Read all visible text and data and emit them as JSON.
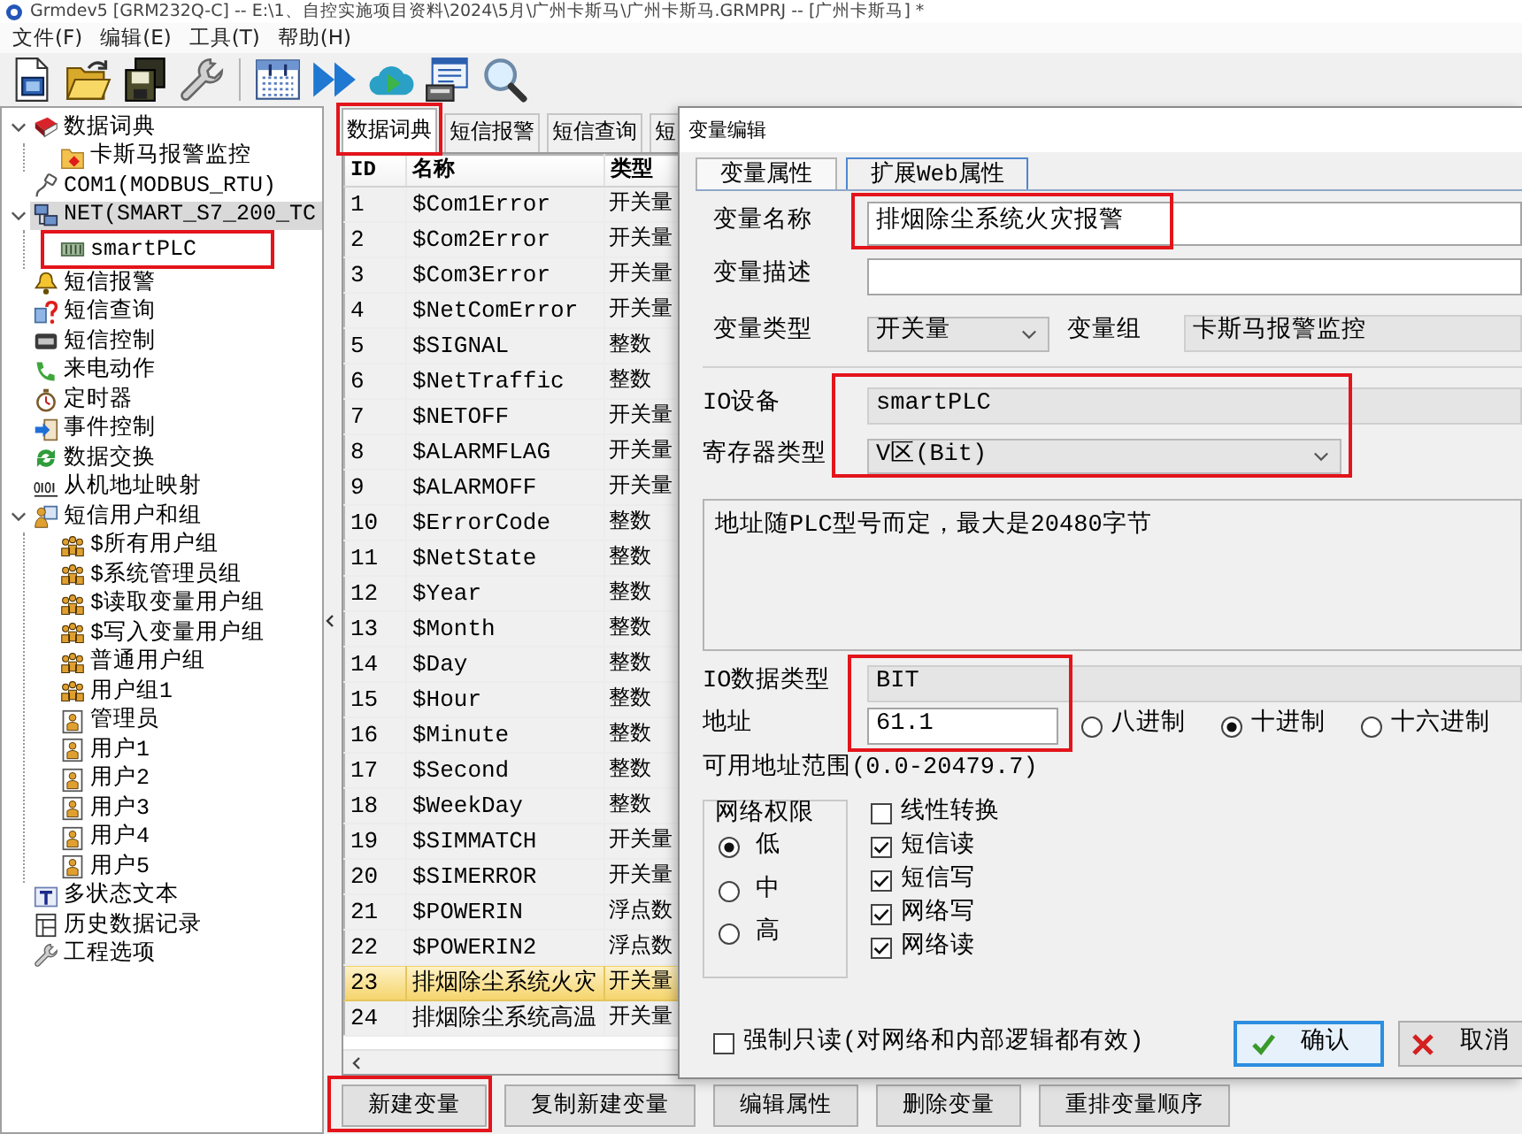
{
  "window": {
    "title": "Grmdev5 [GRM232Q-C]  -- E:\\1、自控实施项目资料\\2024\\5月\\广州卡斯马\\广州卡斯马.GRMPRJ -- [广州卡斯马] *"
  },
  "menu": [
    "文件(F)",
    "编辑(E)",
    "工具(T)",
    "帮助(H)"
  ],
  "tree": [
    {
      "label": "数据词典",
      "kind": "dictionary",
      "expanded": true,
      "selected": false,
      "highlighted": false,
      "children": [
        {
          "label": "卡斯马报警监控",
          "kind": "folder",
          "selected": false,
          "highlighted": false
        }
      ]
    },
    {
      "label": "COM1(MODBUS_RTU)",
      "kind": "serial",
      "selected": false,
      "highlighted": false
    },
    {
      "label": "NET(SMART_S7_200_TC",
      "kind": "network",
      "expanded": true,
      "selected": true,
      "highlighted": false,
      "children": [
        {
          "label": "smartPLC",
          "kind": "device",
          "selected": false,
          "highlighted": true
        }
      ]
    },
    {
      "label": "短信报警",
      "kind": "alarm",
      "selected": false,
      "highlighted": false
    },
    {
      "label": "短信查询",
      "kind": "query",
      "selected": false,
      "highlighted": false
    },
    {
      "label": "短信控制",
      "kind": "command",
      "selected": false,
      "highlighted": false
    },
    {
      "label": "来电动作",
      "kind": "call",
      "selected": false,
      "highlighted": false
    },
    {
      "label": "定时器",
      "kind": "timer",
      "selected": false,
      "highlighted": false
    },
    {
      "label": "事件控制",
      "kind": "event",
      "selected": false,
      "highlighted": false
    },
    {
      "label": "数据交换",
      "kind": "exchange",
      "selected": false,
      "highlighted": false
    },
    {
      "label": "从机地址映射",
      "kind": "mapping",
      "selected": false,
      "highlighted": false
    },
    {
      "label": "短信用户和组",
      "kind": "users",
      "expanded": true,
      "selected": false,
      "highlighted": false,
      "children": [
        {
          "label": "$所有用户组",
          "kind": "group",
          "selected": false,
          "highlighted": false
        },
        {
          "label": "$系统管理员组",
          "kind": "group",
          "selected": false,
          "highlighted": false
        },
        {
          "label": "$读取变量用户组",
          "kind": "group",
          "selected": false,
          "highlighted": false
        },
        {
          "label": "$写入变量用户组",
          "kind": "group",
          "selected": false,
          "highlighted": false
        },
        {
          "label": "普通用户组",
          "kind": "group",
          "selected": false,
          "highlighted": false
        },
        {
          "label": "用户组1",
          "kind": "group",
          "selected": false,
          "highlighted": false
        },
        {
          "label": "管理员",
          "kind": "user",
          "selected": false,
          "highlighted": false
        },
        {
          "label": "用户1",
          "kind": "user",
          "selected": false,
          "highlighted": false
        },
        {
          "label": "用户2",
          "kind": "user",
          "selected": false,
          "highlighted": false
        },
        {
          "label": "用户3",
          "kind": "user",
          "selected": false,
          "highlighted": false
        },
        {
          "label": "用户4",
          "kind": "user",
          "selected": false,
          "highlighted": false
        },
        {
          "label": "用户5",
          "kind": "user",
          "selected": false,
          "highlighted": false
        }
      ]
    },
    {
      "label": "多状态文本",
      "kind": "text",
      "selected": false,
      "highlighted": false
    },
    {
      "label": "历史数据记录",
      "kind": "history",
      "selected": false,
      "highlighted": false
    },
    {
      "label": "工程选项",
      "kind": "options",
      "selected": false,
      "highlighted": false
    }
  ],
  "tabs": [
    {
      "label": "数据词典",
      "selected": true,
      "highlighted": true
    },
    {
      "label": "短信报警",
      "selected": false,
      "highlighted": false
    },
    {
      "label": "短信查询",
      "selected": false,
      "highlighted": false
    },
    {
      "label": "短",
      "selected": false,
      "highlighted": false
    }
  ],
  "table": {
    "columns": [
      "ID",
      "名称",
      "类型"
    ],
    "rows": [
      {
        "cells": [
          "1",
          "$Com1Error",
          "开关量"
        ],
        "selected": false
      },
      {
        "cells": [
          "2",
          "$Com2Error",
          "开关量"
        ],
        "selected": false
      },
      {
        "cells": [
          "3",
          "$Com3Error",
          "开关量"
        ],
        "selected": false
      },
      {
        "cells": [
          "4",
          "$NetComError",
          "开关量"
        ],
        "selected": false
      },
      {
        "cells": [
          "5",
          "$SIGNAL",
          "整数"
        ],
        "selected": false
      },
      {
        "cells": [
          "6",
          "$NetTraffic",
          "整数"
        ],
        "selected": false
      },
      {
        "cells": [
          "7",
          "$NETOFF",
          "开关量"
        ],
        "selected": false
      },
      {
        "cells": [
          "8",
          "$ALARMFLAG",
          "开关量"
        ],
        "selected": false
      },
      {
        "cells": [
          "9",
          "$ALARMOFF",
          "开关量"
        ],
        "selected": false
      },
      {
        "cells": [
          "10",
          "$ErrorCode",
          "整数"
        ],
        "selected": false
      },
      {
        "cells": [
          "11",
          "$NetState",
          "整数"
        ],
        "selected": false
      },
      {
        "cells": [
          "12",
          "$Year",
          "整数"
        ],
        "selected": false
      },
      {
        "cells": [
          "13",
          "$Month",
          "整数"
        ],
        "selected": false
      },
      {
        "cells": [
          "14",
          "$Day",
          "整数"
        ],
        "selected": false
      },
      {
        "cells": [
          "15",
          "$Hour",
          "整数"
        ],
        "selected": false
      },
      {
        "cells": [
          "16",
          "$Minute",
          "整数"
        ],
        "selected": false
      },
      {
        "cells": [
          "17",
          "$Second",
          "整数"
        ],
        "selected": false
      },
      {
        "cells": [
          "18",
          "$WeekDay",
          "整数"
        ],
        "selected": false
      },
      {
        "cells": [
          "19",
          "$SIMMATCH",
          "开关量"
        ],
        "selected": false
      },
      {
        "cells": [
          "20",
          "$SIMERROR",
          "开关量"
        ],
        "selected": false
      },
      {
        "cells": [
          "21",
          "$POWERIN",
          "浮点数"
        ],
        "selected": false
      },
      {
        "cells": [
          "22",
          "$POWERIN2",
          "浮点数"
        ],
        "selected": false
      },
      {
        "cells": [
          "23",
          "排烟除尘系统火灾",
          "开关量"
        ],
        "selected": true
      },
      {
        "cells": [
          "24",
          "排烟除尘系统高温",
          "开关量"
        ],
        "selected": false
      }
    ]
  },
  "buttons": [
    {
      "label": "新建变量",
      "highlighted": true
    },
    {
      "label": "复制新建变量",
      "highlighted": false
    },
    {
      "label": "编辑属性",
      "highlighted": false
    },
    {
      "label": "删除变量",
      "highlighted": false
    },
    {
      "label": "重排变量顺序",
      "highlighted": false
    }
  ],
  "dialog": {
    "title": "变量编辑",
    "tabs": [
      {
        "label": "变量属性",
        "selected": true
      },
      {
        "label": "扩展Web属性",
        "selected": false
      }
    ],
    "name_field": {
      "label": "变量名称",
      "value": "排烟除尘系统火灾报警",
      "highlighted": true
    },
    "description_field": {
      "label": "变量描述"
    },
    "type_field": {
      "label": "变量类型",
      "value": "开关量"
    },
    "group_field": {
      "label": "变量组",
      "value": "卡斯马报警监控"
    },
    "io_section": {
      "highlighted": true,
      "device": {
        "label": "IO设备",
        "value": "smartPLC"
      },
      "register_type": {
        "label": "寄存器类型",
        "value": "V区(Bit)"
      }
    },
    "note": "地址随PLC型号而定，最大是20480字节",
    "address_section": {
      "highlighted": true,
      "data_type": {
        "label": "IO数据类型",
        "value": "BIT"
      },
      "address": {
        "label": "地址",
        "value": "61.1"
      },
      "radix": [
        {
          "label": "八进制",
          "selected": false
        },
        {
          "label": "十进制",
          "selected": true
        },
        {
          "label": "十六进制",
          "selected": false
        }
      ]
    },
    "range_label": "可用地址范围(0.0-20479.7)",
    "permissions": {
      "title": "网络权限",
      "options": [
        {
          "label": "低",
          "selected": true
        },
        {
          "label": "中",
          "selected": false
        },
        {
          "label": "高",
          "selected": false
        }
      ]
    },
    "options": [
      {
        "label": "线性转换",
        "checked": false
      },
      {
        "label": "短信读",
        "checked": true
      },
      {
        "label": "短信写",
        "checked": true
      },
      {
        "label": "网络写",
        "checked": true
      },
      {
        "label": "网络读",
        "checked": true
      }
    ],
    "read_only": {
      "label": "强制只读(对网络和内部逻辑都有效)",
      "checked": false
    },
    "actions": [
      {
        "label": "确认",
        "kind": "confirm"
      },
      {
        "label": "取消",
        "kind": "cancel"
      }
    ]
  }
}
